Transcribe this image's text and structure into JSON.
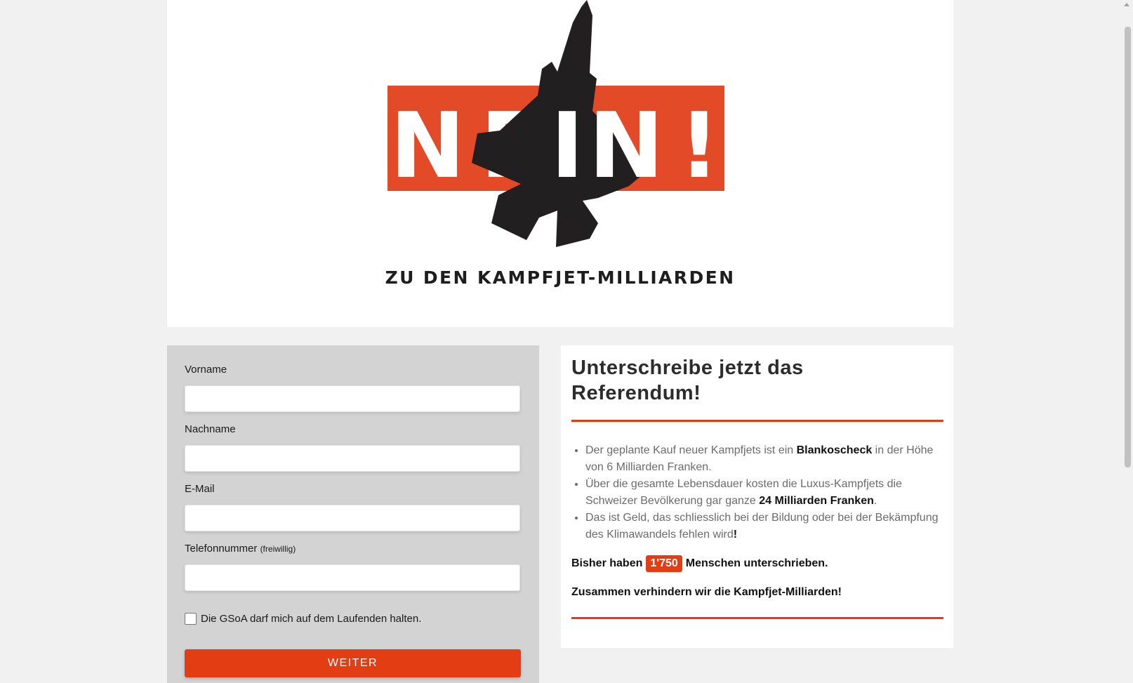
{
  "hero": {
    "logo_word": "NEIN!",
    "logo_letters": [
      "N",
      "E",
      "I",
      "N",
      "!"
    ],
    "tagline": "ZU DEN KAMPFJET-MILLIARDEN"
  },
  "form": {
    "first_name_label": "Vorname",
    "last_name_label": "Nachname",
    "email_label": "E-Mail",
    "phone_label": "Telefonnummer",
    "phone_optional": "(freiwillig)",
    "first_name_value": "",
    "last_name_value": "",
    "email_value": "",
    "phone_value": "",
    "newsletter_label": "Die GSoA darf mich auf dem Laufenden halten.",
    "newsletter_checked": false,
    "submit_label": "WEITER"
  },
  "info": {
    "title": "Unterschreibe jetzt das Referendum!",
    "bullets": [
      {
        "before": "Der geplante Kauf neuer Kampfjets ist ein ",
        "bold": "Blankoscheck",
        "after": " in der Höhe von 6 Milliarden Franken."
      },
      {
        "before": "Über die gesamte Lebensdauer kosten die Luxus-Kampfjets die Schweizer Bevölkerung gar ganze ",
        "bold": "24 Milliarden Franken",
        "after": "."
      },
      {
        "before": "Das ist Geld, das schliesslich bei der Bildung oder bei der Bekämpfung des Klimawandels fehlen wird",
        "bold": "!",
        "after": ""
      }
    ],
    "count_prefix": "Bisher haben",
    "count_value": "1'750",
    "count_suffix": "Menschen unterschrieben.",
    "closing": "Zusammen verhindern wir die Kampfjet-Milliarden!"
  },
  "colors": {
    "accent": "#e23d13",
    "logo_red": "#e34a27",
    "jet": "#221f20",
    "form_bg": "#d3d3d3",
    "page_bg": "#f1f1f1"
  }
}
